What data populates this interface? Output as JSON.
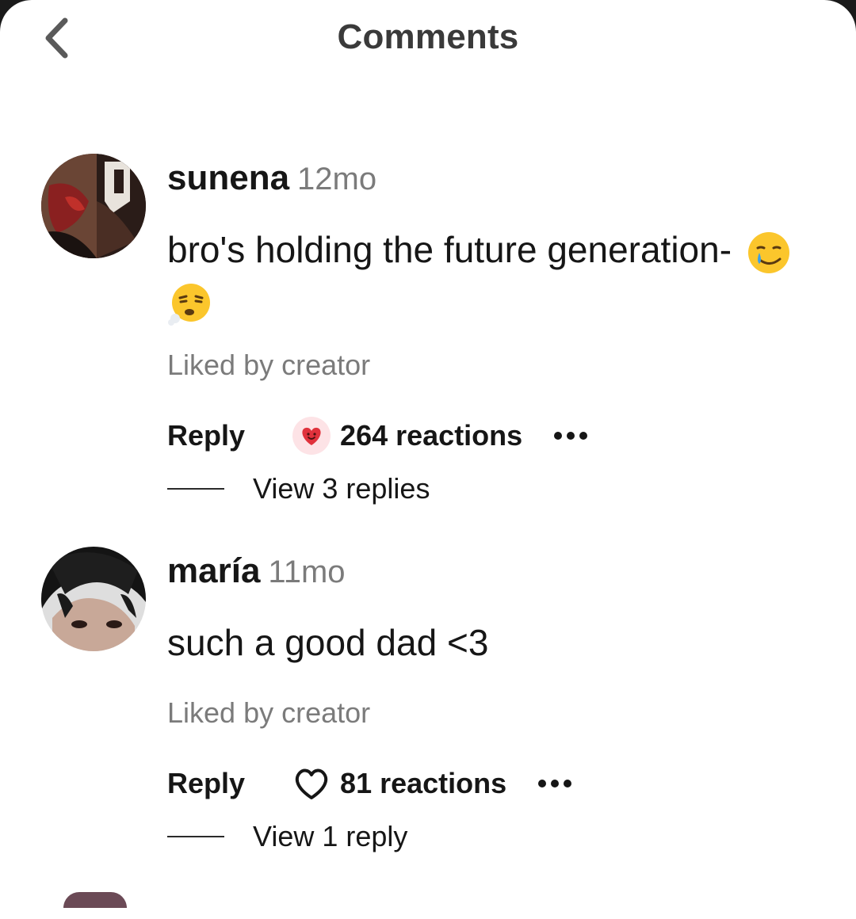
{
  "header": {
    "title": "Comments",
    "back_icon": "chevron-left-icon"
  },
  "comments": [
    {
      "username": "sunena",
      "time": "12mo",
      "text": "bro's holding the future generation-",
      "emojis": [
        "smiling-face-with-tear-emoji",
        "face-exhaling-emoji"
      ],
      "liked_by": "Liked by creator",
      "reply_label": "Reply",
      "reaction_icon": "heart-face-reaction-icon",
      "reactions": "264 reactions",
      "view_replies": "View 3 replies"
    },
    {
      "username": "maría",
      "time": "11mo",
      "text": "such a good dad <3",
      "liked_by": "Liked by creator",
      "reply_label": "Reply",
      "reaction_icon": "heart-outline-icon",
      "reactions": "81 reactions",
      "view_replies": "View 1 reply"
    }
  ],
  "colors": {
    "text": "#161616",
    "muted": "#7b7b7b",
    "reaction_red": "#e0323c",
    "reaction_bg": "#fde3e6"
  }
}
